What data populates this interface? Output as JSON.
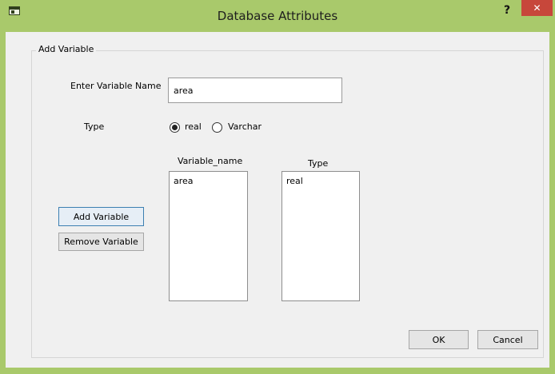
{
  "window": {
    "title": "Database Attributes",
    "help_label": "?",
    "close_label": "✕"
  },
  "group": {
    "title": "Add Variable"
  },
  "name_field": {
    "label": "Enter Variable Name",
    "value": "area"
  },
  "type_field": {
    "label": "Type",
    "options": [
      {
        "label": "real",
        "checked": true
      },
      {
        "label": "Varchar",
        "checked": false
      }
    ]
  },
  "lists": {
    "name_header": "Variable_name",
    "type_header": "Type",
    "names": [
      "area"
    ],
    "types": [
      "real"
    ]
  },
  "buttons": {
    "add": "Add  Variable",
    "remove": "Remove Variable",
    "ok": "OK",
    "cancel": "Cancel"
  },
  "colors": {
    "titlebar": "#a9c96b",
    "close": "#c7473b"
  }
}
